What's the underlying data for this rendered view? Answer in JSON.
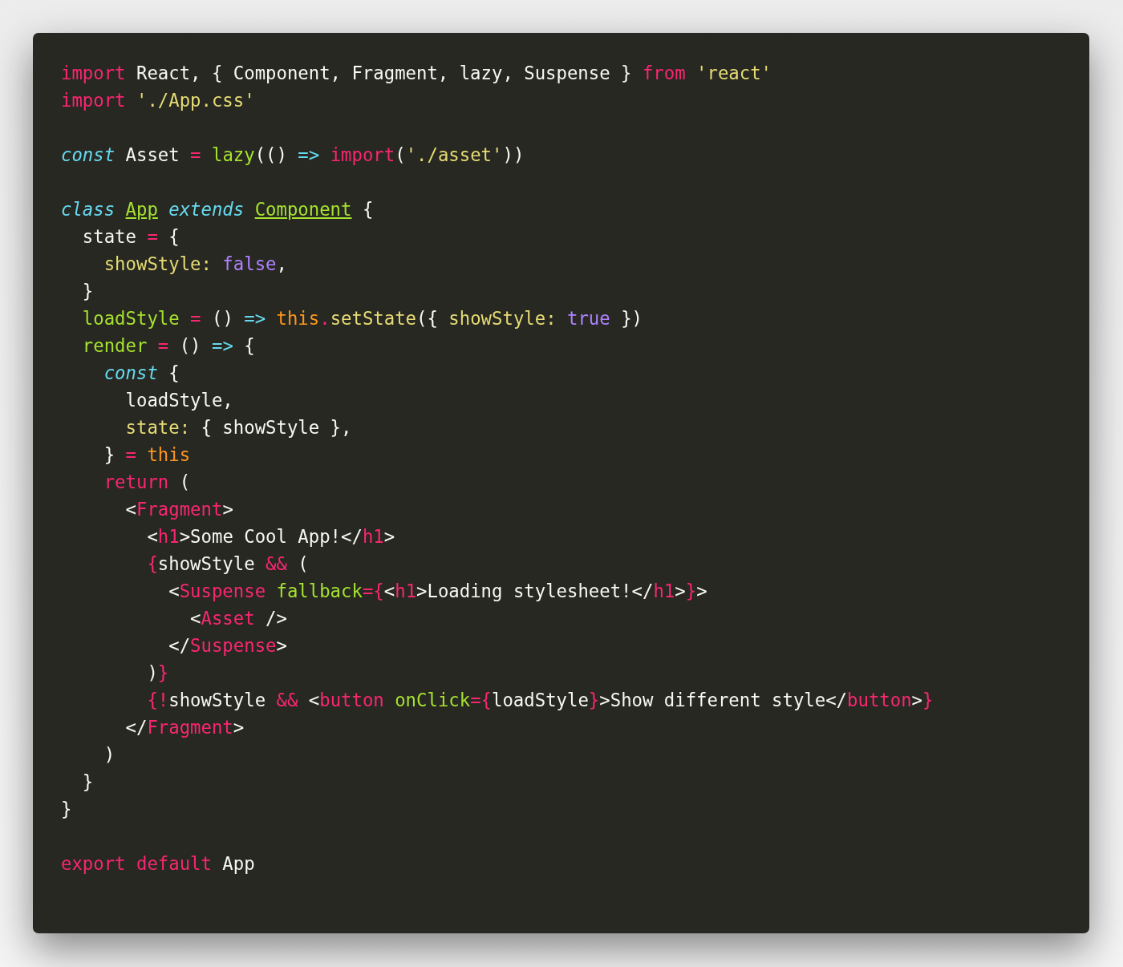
{
  "code_lines": [
    {
      "kind": "code",
      "tokens": [
        {
          "text": "import",
          "kind": "keyword"
        },
        {
          "text": " React, { Component, Fragment, lazy, Suspense } ",
          "kind": "plain"
        },
        {
          "text": "from ",
          "kind": "keyword"
        },
        {
          "text": "'react'",
          "kind": "string"
        }
      ]
    },
    {
      "kind": "code",
      "tokens": [
        {
          "text": "import ",
          "kind": "keyword"
        },
        {
          "text": "'./App.css'",
          "kind": "string"
        }
      ]
    },
    {
      "kind": "blank"
    },
    {
      "kind": "code",
      "tokens": [
        {
          "text": "const",
          "kind": "storage"
        },
        {
          "text": " Asset ",
          "kind": "plain"
        },
        {
          "text": "= ",
          "kind": "keyword"
        },
        {
          "text": "lazy",
          "kind": "function"
        },
        {
          "text": "(() ",
          "kind": "plain"
        },
        {
          "text": "=> ",
          "kind": "arrow"
        },
        {
          "text": "import",
          "kind": "keyword"
        },
        {
          "text": "(",
          "kind": "plain"
        },
        {
          "text": "'./asset'",
          "kind": "string"
        },
        {
          "text": "))",
          "kind": "plain"
        }
      ]
    },
    {
      "kind": "blank"
    },
    {
      "kind": "code",
      "tokens": [
        {
          "text": "class ",
          "kind": "storage"
        },
        {
          "text": "App",
          "kind": "entity"
        },
        {
          "text": " extends ",
          "kind": "storage"
        },
        {
          "text": "Component",
          "kind": "entity"
        },
        {
          "text": " {",
          "kind": "plain"
        }
      ]
    },
    {
      "kind": "code",
      "tokens": [
        {
          "text": "  state ",
          "kind": "plain"
        },
        {
          "text": "=",
          "kind": "keyword"
        },
        {
          "text": " {",
          "kind": "plain"
        }
      ]
    },
    {
      "kind": "code",
      "tokens": [
        {
          "text": "    showStyle: ",
          "kind": "property"
        },
        {
          "text": "false",
          "kind": "constant"
        },
        {
          "text": ",",
          "kind": "plain"
        }
      ]
    },
    {
      "kind": "code",
      "tokens": [
        {
          "text": "  }",
          "kind": "plain"
        }
      ]
    },
    {
      "kind": "code",
      "tokens": [
        {
          "text": "  loadStyle ",
          "kind": "function"
        },
        {
          "text": "=",
          "kind": "keyword"
        },
        {
          "text": " () ",
          "kind": "plain"
        },
        {
          "text": "=> ",
          "kind": "arrow"
        },
        {
          "text": "this",
          "kind": "this"
        },
        {
          "text": ".",
          "kind": "keyword"
        },
        {
          "text": "setState",
          "kind": "property"
        },
        {
          "text": "({ ",
          "kind": "plain"
        },
        {
          "text": "showStyle: ",
          "kind": "property"
        },
        {
          "text": "true",
          "kind": "constant"
        },
        {
          "text": " })",
          "kind": "plain"
        }
      ]
    },
    {
      "kind": "code",
      "tokens": [
        {
          "text": "  render ",
          "kind": "function"
        },
        {
          "text": "=",
          "kind": "keyword"
        },
        {
          "text": " () ",
          "kind": "plain"
        },
        {
          "text": "=>",
          "kind": "arrow"
        },
        {
          "text": " {",
          "kind": "plain"
        }
      ]
    },
    {
      "kind": "code",
      "tokens": [
        {
          "text": "    const",
          "kind": "storage"
        },
        {
          "text": " {",
          "kind": "plain"
        }
      ]
    },
    {
      "kind": "code",
      "tokens": [
        {
          "text": "      loadStyle,",
          "kind": "plain"
        }
      ]
    },
    {
      "kind": "code",
      "tokens": [
        {
          "text": "      state:",
          "kind": "property"
        },
        {
          "text": " { showStyle },",
          "kind": "plain"
        }
      ]
    },
    {
      "kind": "code",
      "tokens": [
        {
          "text": "    } ",
          "kind": "plain"
        },
        {
          "text": "= ",
          "kind": "keyword"
        },
        {
          "text": "this",
          "kind": "this"
        }
      ]
    },
    {
      "kind": "code",
      "tokens": [
        {
          "text": "    return",
          "kind": "keyword"
        },
        {
          "text": " (",
          "kind": "plain"
        }
      ]
    },
    {
      "kind": "code",
      "tokens": [
        {
          "text": "      <",
          "kind": "plain"
        },
        {
          "text": "Fragment",
          "kind": "keyword"
        },
        {
          "text": ">",
          "kind": "plain"
        }
      ]
    },
    {
      "kind": "code",
      "tokens": [
        {
          "text": "        <",
          "kind": "plain"
        },
        {
          "text": "h1",
          "kind": "keyword"
        },
        {
          "text": ">Some Cool App!</",
          "kind": "plain"
        },
        {
          "text": "h1",
          "kind": "keyword"
        },
        {
          "text": ">",
          "kind": "plain"
        }
      ]
    },
    {
      "kind": "code",
      "tokens": [
        {
          "text": "        {",
          "kind": "keyword"
        },
        {
          "text": "showStyle ",
          "kind": "plain"
        },
        {
          "text": "&&",
          "kind": "keyword"
        },
        {
          "text": " (",
          "kind": "plain"
        }
      ]
    },
    {
      "kind": "code",
      "tokens": [
        {
          "text": "          <",
          "kind": "plain"
        },
        {
          "text": "Suspense ",
          "kind": "keyword"
        },
        {
          "text": "fallback",
          "kind": "function"
        },
        {
          "text": "={",
          "kind": "keyword"
        },
        {
          "text": "<",
          "kind": "plain"
        },
        {
          "text": "h1",
          "kind": "keyword"
        },
        {
          "text": ">Loading stylesheet!</",
          "kind": "plain"
        },
        {
          "text": "h1",
          "kind": "keyword"
        },
        {
          "text": ">",
          "kind": "plain"
        },
        {
          "text": "}",
          "kind": "keyword"
        },
        {
          "text": ">",
          "kind": "plain"
        }
      ]
    },
    {
      "kind": "code",
      "tokens": [
        {
          "text": "            <",
          "kind": "plain"
        },
        {
          "text": "Asset",
          "kind": "keyword"
        },
        {
          "text": " />",
          "kind": "plain"
        }
      ]
    },
    {
      "kind": "code",
      "tokens": [
        {
          "text": "          </",
          "kind": "plain"
        },
        {
          "text": "Suspense",
          "kind": "keyword"
        },
        {
          "text": ">",
          "kind": "plain"
        }
      ]
    },
    {
      "kind": "code",
      "tokens": [
        {
          "text": "        )",
          "kind": "plain"
        },
        {
          "text": "}",
          "kind": "keyword"
        }
      ]
    },
    {
      "kind": "code",
      "tokens": [
        {
          "text": "        {!",
          "kind": "keyword"
        },
        {
          "text": "showStyle ",
          "kind": "plain"
        },
        {
          "text": "&&",
          "kind": "keyword"
        },
        {
          "text": " <",
          "kind": "plain"
        },
        {
          "text": "button ",
          "kind": "keyword"
        },
        {
          "text": "onClick",
          "kind": "function"
        },
        {
          "text": "={",
          "kind": "keyword"
        },
        {
          "text": "loadStyle",
          "kind": "plain"
        },
        {
          "text": "}",
          "kind": "keyword"
        },
        {
          "text": ">Show different style</",
          "kind": "plain"
        },
        {
          "text": "button",
          "kind": "keyword"
        },
        {
          "text": ">",
          "kind": "plain"
        },
        {
          "text": "}",
          "kind": "keyword"
        }
      ]
    },
    {
      "kind": "code",
      "tokens": [
        {
          "text": "      </",
          "kind": "plain"
        },
        {
          "text": "Fragment",
          "kind": "keyword"
        },
        {
          "text": ">",
          "kind": "plain"
        }
      ]
    },
    {
      "kind": "code",
      "tokens": [
        {
          "text": "    )",
          "kind": "plain"
        }
      ]
    },
    {
      "kind": "code",
      "tokens": [
        {
          "text": "  }",
          "kind": "plain"
        }
      ]
    },
    {
      "kind": "code",
      "tokens": [
        {
          "text": "}",
          "kind": "plain"
        }
      ]
    },
    {
      "kind": "blank"
    },
    {
      "kind": "code",
      "tokens": [
        {
          "text": "export default ",
          "kind": "keyword"
        },
        {
          "text": "App",
          "kind": "plain"
        }
      ]
    }
  ]
}
